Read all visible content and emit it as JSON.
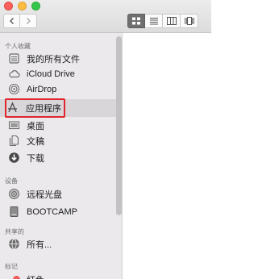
{
  "toolbar": {
    "back": "‹",
    "forward": "›",
    "views": [
      "icon-view",
      "list-view",
      "column-view",
      "coverflow-view"
    ]
  },
  "sidebar": {
    "favorites_header": "个人收藏",
    "favorites": [
      {
        "label": "我的所有文件",
        "icon": "all-files-icon"
      },
      {
        "label": "iCloud Drive",
        "icon": "icloud-icon"
      },
      {
        "label": "AirDrop",
        "icon": "airdrop-icon"
      },
      {
        "label": "应用程序",
        "icon": "applications-icon",
        "selected": true
      },
      {
        "label": "桌面",
        "icon": "desktop-icon"
      },
      {
        "label": "文稿",
        "icon": "documents-icon"
      },
      {
        "label": "下载",
        "icon": "downloads-icon"
      }
    ],
    "devices_header": "设备",
    "devices": [
      {
        "label": "远程光盘",
        "icon": "remote-disc-icon"
      },
      {
        "label": "BOOTCAMP",
        "icon": "drive-icon"
      }
    ],
    "shared_header": "共享的",
    "shared": [
      {
        "label": "所有...",
        "icon": "network-icon"
      }
    ],
    "tags_header": "标记",
    "tags": [
      {
        "label": "红色",
        "color": "#f35b5a"
      }
    ]
  },
  "colors": {
    "highlight_border": "#e0252c",
    "sidebar_bg": "#ebe9ec"
  }
}
